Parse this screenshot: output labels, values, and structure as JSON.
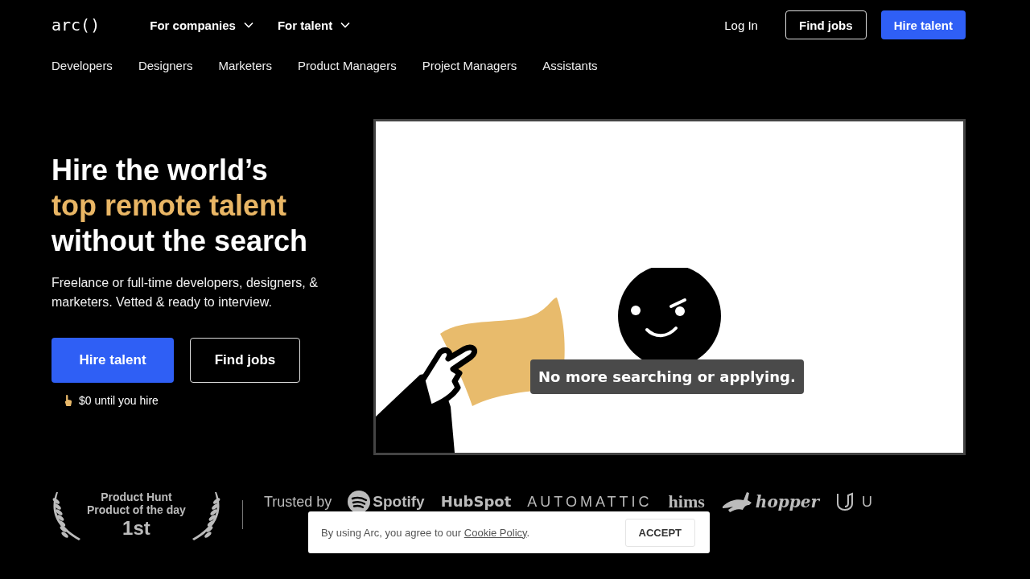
{
  "header": {
    "logo": "arc()",
    "menus": [
      {
        "label": "For companies",
        "expanded": false
      },
      {
        "label": "For talent",
        "expanded": false
      }
    ],
    "login": "Log In",
    "find_jobs": "Find jobs",
    "hire_talent": "Hire talent"
  },
  "subnav": [
    "Developers",
    "Designers",
    "Marketers",
    "Product Managers",
    "Project Managers",
    "Assistants"
  ],
  "hero": {
    "headline": [
      {
        "text": "Hire the world’s",
        "highlight": false
      },
      {
        "text": "top remote talent",
        "highlight": true
      },
      {
        "text": "without the search",
        "highlight": false
      }
    ],
    "subtitle": "Freelance or full-time developers, designers, & marketers. Vetted & ready to interview.",
    "primary_button": "Hire talent",
    "secondary_button": "Find jobs",
    "note": "$0 until you hire"
  },
  "video": {
    "caption": "No more searching or applying."
  },
  "award": {
    "line_1": "Product Hunt",
    "line_2": "Product of the day",
    "rank": "1st"
  },
  "trusted": {
    "label": "Trusted by",
    "logos": [
      {
        "kind": "spotify",
        "text": "Spotify"
      },
      {
        "kind": "hubspot",
        "text": "HubSpot"
      },
      {
        "kind": "automattic",
        "text": "AUTOMATTIC"
      },
      {
        "kind": "hims",
        "text": "hims"
      },
      {
        "kind": "hopper",
        "text": "hopper"
      },
      {
        "kind": "udacity",
        "text": "U"
      }
    ]
  },
  "cookie_banner": {
    "text": "By using Arc, you agree to our ",
    "link": "Cookie Policy",
    "after": ".",
    "button": "ACCEPT"
  }
}
